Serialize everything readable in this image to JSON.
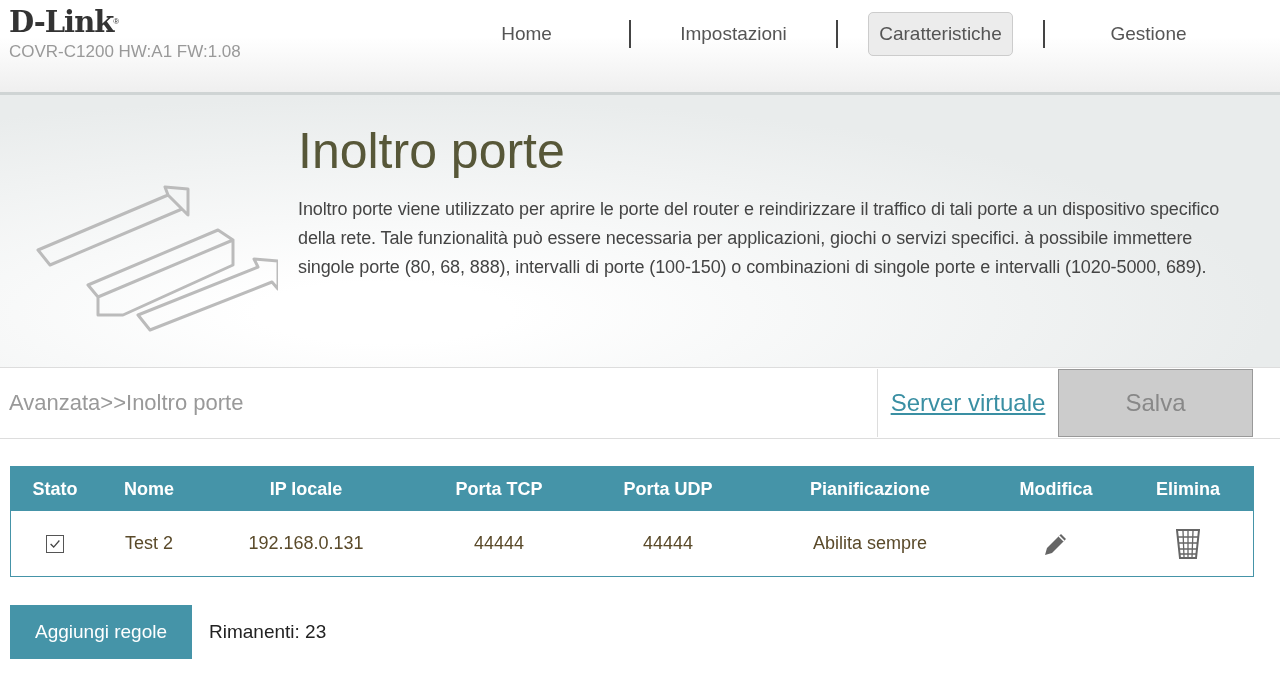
{
  "brand": {
    "logo": "D-Link",
    "trademark": "®",
    "model": "COVR-C1200 HW:A1 FW:1.08"
  },
  "nav": [
    {
      "label": "Home",
      "selected": false
    },
    {
      "label": "Impostazioni",
      "selected": false
    },
    {
      "label": "Caratteristiche",
      "selected": true
    },
    {
      "label": "Gestione",
      "selected": false
    }
  ],
  "hero": {
    "title": "Inoltro porte",
    "description": "Inoltro porte viene utilizzato per aprire le porte del router e reindirizzare il traffico di tali porte a un dispositivo specifico della rete. Tale funzionalità può essere necessaria per applicazioni, giochi o servizi specifici. à possibile immettere singole porte (80, 68, 888), intervalli di porte (100-150) o combinazioni di singole porte e intervalli (1020-5000, 689)."
  },
  "breadcrumb": "Avanzata>>Inoltro porte",
  "link": "Server virtuale",
  "save": {
    "label": "Salva",
    "disabled": true
  },
  "table": {
    "columns": [
      "Stato",
      "Nome",
      "IP locale",
      "Porta TCP",
      "Porta UDP",
      "Pianificazione",
      "Modifica",
      "Elimina"
    ],
    "rows": [
      {
        "checked": true,
        "name": "Test 2",
        "ip": "192.168.0.131",
        "tcp": "44444",
        "udp": "44444",
        "schedule": "Abilita sempre"
      }
    ]
  },
  "add_button": "Aggiungi regole",
  "remaining": "Rimanenti: 23"
}
